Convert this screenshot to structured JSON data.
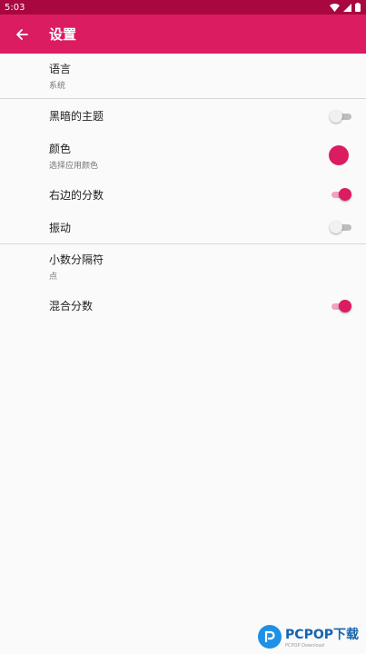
{
  "status_bar": {
    "time": "5:03"
  },
  "app_bar": {
    "title": "设置"
  },
  "settings": {
    "language": {
      "title": "语言",
      "subtitle": "系统"
    },
    "dark_theme": {
      "title": "黑暗的主题",
      "enabled": false
    },
    "color": {
      "title": "颜色",
      "subtitle": "选择应用颜色",
      "value": "#db1c61"
    },
    "right_score": {
      "title": "右边的分数",
      "enabled": true
    },
    "vibration": {
      "title": "振动",
      "enabled": false
    },
    "decimal_separator": {
      "title": "小数分隔符",
      "subtitle": "点"
    },
    "mixed_fraction": {
      "title": "混合分数",
      "enabled": true
    }
  },
  "watermark": {
    "text": "PCPOP下载",
    "sub": "PCPOP Download"
  },
  "colors": {
    "primary": "#db1c61",
    "status_bar": "#a8073f",
    "background": "#fafafa"
  }
}
